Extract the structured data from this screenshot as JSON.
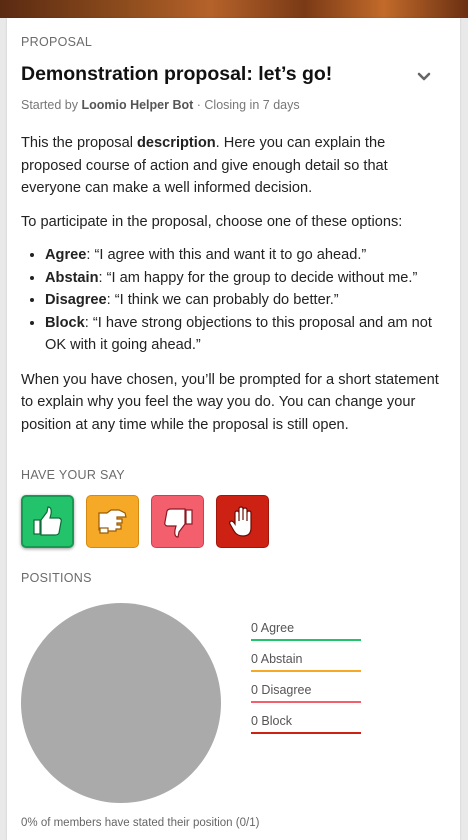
{
  "proposal": {
    "section_label": "PROPOSAL",
    "title": "Demonstration proposal: let’s go!",
    "started_by_prefix": "Started by",
    "author": "Loomio Helper Bot",
    "closing": "· Closing in 7 days"
  },
  "description": {
    "p1_pre": "This the proposal ",
    "p1_bold": "description",
    "p1_post": ". Here you can explain the proposed course of action and give enough detail so that everyone can make a well informed decision.",
    "p2": "To participate in the proposal, choose one of these options:",
    "options": [
      {
        "name": "Agree",
        "text": ": “I agree with this and want it to go ahead.”"
      },
      {
        "name": "Abstain",
        "text": ": “I am happy for the group to decide without me.”"
      },
      {
        "name": "Disagree",
        "text": ": “I think we can probably do better.”"
      },
      {
        "name": "Block",
        "text": ": “I have strong objections to this proposal and am not OK with it going ahead.”"
      }
    ],
    "p3": "When you have chosen, you’ll be prompted for a short statement to explain why you feel the way you do. You can change your position at any time while the proposal is still open."
  },
  "have_your_say": {
    "label": "HAVE YOUR SAY",
    "buttons": [
      {
        "name": "agree",
        "icon": "thumbs-up-icon",
        "color": "#22c36b"
      },
      {
        "name": "abstain",
        "icon": "thumbs-sideways-icon",
        "color": "#f6a927"
      },
      {
        "name": "disagree",
        "icon": "thumbs-down-icon",
        "color": "#f45f6e"
      },
      {
        "name": "block",
        "icon": "raised-hand-icon",
        "color": "#cc2113"
      }
    ]
  },
  "positions": {
    "label": "POSITIONS",
    "pie_color": "#aaaaaa",
    "legend": [
      {
        "label": "0 Agree",
        "color": "#22c36b"
      },
      {
        "label": "0 Abstain",
        "color": "#f6a927"
      },
      {
        "label": "0 Disagree",
        "color": "#f45f6e"
      },
      {
        "label": "0 Block",
        "color": "#cc2113"
      }
    ],
    "summary": "0% of members have stated their position (0/1)"
  }
}
